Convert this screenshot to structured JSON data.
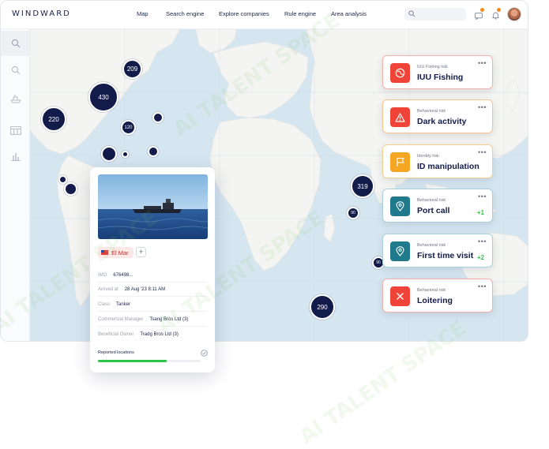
{
  "app": {
    "logo": "WINDWARD"
  },
  "nav": [
    {
      "label": "Map"
    },
    {
      "label": "Search engine"
    },
    {
      "label": "Explore companies"
    },
    {
      "label": "Rule engine"
    },
    {
      "label": "Area analysis"
    }
  ],
  "icons": {
    "search": "search-icon",
    "messages": "message-icon",
    "notifications": "bell-icon",
    "sidebar": [
      "search-icon",
      "search-icon",
      "ship-icon",
      "table-icon",
      "bar-chart-icon"
    ]
  },
  "colors": {
    "brand_navy": "#121b4a",
    "map_water": "#d6e6f1",
    "map_land": "#f4f4f2",
    "accent_orange": "#f28c1a",
    "success": "#2ec44a"
  },
  "clusters": [
    "209",
    "430",
    "220",
    "120",
    "319",
    "90",
    "90",
    "290"
  ],
  "vessel": {
    "name": "El Mar",
    "fields": [
      {
        "key": "IMO",
        "value": "676498..."
      },
      {
        "key": "Arrived at",
        "value": "28 Aug '23 8:11 AM"
      },
      {
        "key": "Class",
        "value": "Tanker"
      },
      {
        "key": "Commercial Manager",
        "value": "Tsang Bros Ltd (3)"
      },
      {
        "key": "Beneficial Owner",
        "value": "Tradg Bros Ltd (3)"
      }
    ],
    "reported_locations_label": "Reported locations",
    "reported_locations_progress": 0.67
  },
  "risks": [
    {
      "category": "IUU Fishing risk",
      "title": "IUU Fishing",
      "icon": "fish-globe-icon",
      "color": "#f04438",
      "border": "#f3b1a9",
      "delta": ""
    },
    {
      "category": "Behavioral risk",
      "title": "Dark activity",
      "icon": "warning-icon",
      "color": "#f04438",
      "border": "#f6c48f",
      "delta": ""
    },
    {
      "category": "Identity risk",
      "title": "ID manipulation",
      "icon": "flag-icon",
      "color": "#f5a623",
      "border": "#f6d08f",
      "delta": ""
    },
    {
      "category": "Behavioral risk",
      "title": "Port call",
      "icon": "location-pin-icon",
      "color": "#1f7a8c",
      "border": "#a8d1dc",
      "delta": "+1"
    },
    {
      "category": "Behavioral risk",
      "title": "First time visit",
      "icon": "location-pin-icon",
      "color": "#1f7a8c",
      "border": "#a8d1dc",
      "delta": "+2"
    },
    {
      "category": "Behavioral risk",
      "title": "Loitering",
      "icon": "close-icon",
      "color": "#f04438",
      "border": "#f3b1a9",
      "delta": ""
    }
  ],
  "watermark": "AI TALENT SPACE"
}
